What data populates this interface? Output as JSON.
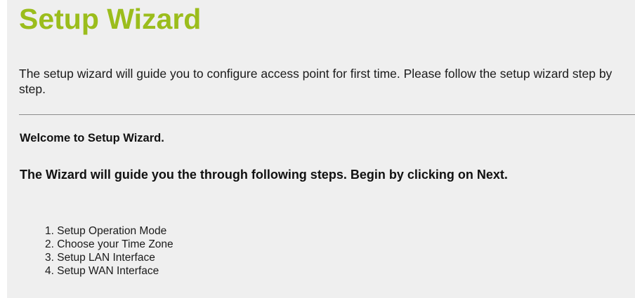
{
  "header": {
    "title": "Setup Wizard"
  },
  "intro": {
    "text": "The setup wizard will guide you to configure access point for first time. Please follow the setup wizard step by step."
  },
  "welcome": {
    "text": "Welcome to Setup Wizard."
  },
  "guide": {
    "text": "The Wizard will guide you the through following steps. Begin by clicking on Next."
  },
  "steps": [
    "1. Setup Operation Mode",
    "2. Choose your Time Zone",
    "3. Setup LAN Interface",
    "4. Setup WAN Interface"
  ],
  "colors": {
    "title": "#9bbd1c",
    "background": "#efefef"
  }
}
